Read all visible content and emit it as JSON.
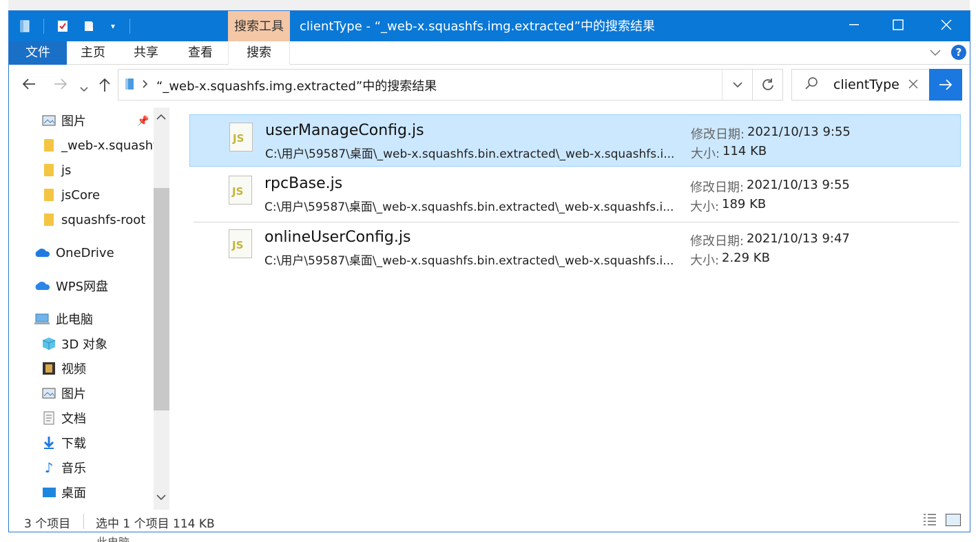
{
  "window": {
    "title": "clientType - “_web-x.squashfs.img.extracted”中的搜索结果",
    "context_tab": "搜索工具"
  },
  "ribbon": {
    "tabs": [
      "文件",
      "主页",
      "共享",
      "查看",
      "搜索"
    ],
    "help_label": "?"
  },
  "address": {
    "breadcrumb": "“_web-x.squashfs.img.extracted”中的搜索结果"
  },
  "search": {
    "value": "clientType"
  },
  "sidebar": {
    "quick_access": [
      {
        "label": "图片",
        "icon": "pictures-icon"
      },
      {
        "label": "_web-x.squashf",
        "icon": "folder-icon"
      },
      {
        "label": "js",
        "icon": "folder-icon"
      },
      {
        "label": "jsCore",
        "icon": "folder-icon"
      },
      {
        "label": "squashfs-root",
        "icon": "folder-icon"
      }
    ],
    "onedrive": "OneDrive",
    "wps": "WPS网盘",
    "this_pc": "此电脑",
    "pc_items": [
      {
        "label": "3D 对象",
        "icon": "3d-objects-icon"
      },
      {
        "label": "视频",
        "icon": "videos-icon"
      },
      {
        "label": "图片",
        "icon": "pictures-icon"
      },
      {
        "label": "文档",
        "icon": "documents-icon"
      },
      {
        "label": "下载",
        "icon": "downloads-icon"
      },
      {
        "label": "音乐",
        "icon": "music-icon"
      },
      {
        "label": "桌面",
        "icon": "desktop-icon"
      }
    ]
  },
  "results": [
    {
      "name": "userManageConfig.js",
      "path": "C:\\用户\\59587\\桌面\\_web-x.squashfs.bin.extracted\\_web-x.squashfs.i...",
      "date_label": "修改日期:",
      "date": "2021/10/13 9:55",
      "size_label": "大小:",
      "size": "114 KB",
      "selected": true
    },
    {
      "name": "rpcBase.js",
      "path": "C:\\用户\\59587\\桌面\\_web-x.squashfs.bin.extracted\\_web-x.squashfs.i...",
      "date_label": "修改日期:",
      "date": "2021/10/13 9:55",
      "size_label": "大小:",
      "size": "189 KB",
      "selected": false
    },
    {
      "name": "onlineUserConfig.js",
      "path": "C:\\用户\\59587\\桌面\\_web-x.squashfs.bin.extracted\\_web-x.squashfs.i...",
      "date_label": "修改日期:",
      "date": "2021/10/13 9:47",
      "size_label": "大小:",
      "size": "2.29 KB",
      "selected": false
    }
  ],
  "file_icon_text": "JS",
  "status": {
    "count": "3 个项目",
    "selection": "选中 1 个项目  114 KB"
  },
  "background": {
    "ghost_label": "此电脑"
  },
  "colors": {
    "titlebar": "#0a78d7",
    "context_tab": "#f4c7a6",
    "selection": "#cce8ff",
    "annotation_arrow": "#e8412c"
  }
}
